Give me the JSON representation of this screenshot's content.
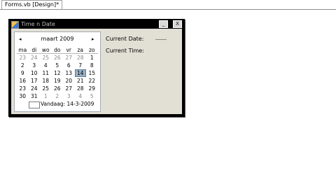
{
  "tab": {
    "label": "Forms.vb [Design]*"
  },
  "form": {
    "title": "Time n Date",
    "minimize_glyph": "_",
    "close_glyph": "X"
  },
  "calendar": {
    "prev_glyph": "◂",
    "next_glyph": "▸",
    "month_title": "maart 2009",
    "weekdays": [
      "ma",
      "di",
      "wo",
      "do",
      "vr",
      "za",
      "zo"
    ],
    "days": [
      [
        "23",
        "24",
        "25",
        "26",
        "27",
        "28",
        "1"
      ],
      [
        "2",
        "3",
        "4",
        "5",
        "6",
        "7",
        "8"
      ],
      [
        "9",
        "10",
        "11",
        "12",
        "13",
        "14",
        "15"
      ],
      [
        "16",
        "17",
        "18",
        "19",
        "20",
        "21",
        "22"
      ],
      [
        "23",
        "24",
        "25",
        "26",
        "27",
        "28",
        "29"
      ],
      [
        "30",
        "31",
        "1",
        "2",
        "3",
        "4",
        "5"
      ]
    ],
    "today_text": "Vandaag: 14-3-2009",
    "selected_day": "14"
  },
  "labels": {
    "current_date": "Current Date:",
    "current_time": "Current Time:"
  }
}
